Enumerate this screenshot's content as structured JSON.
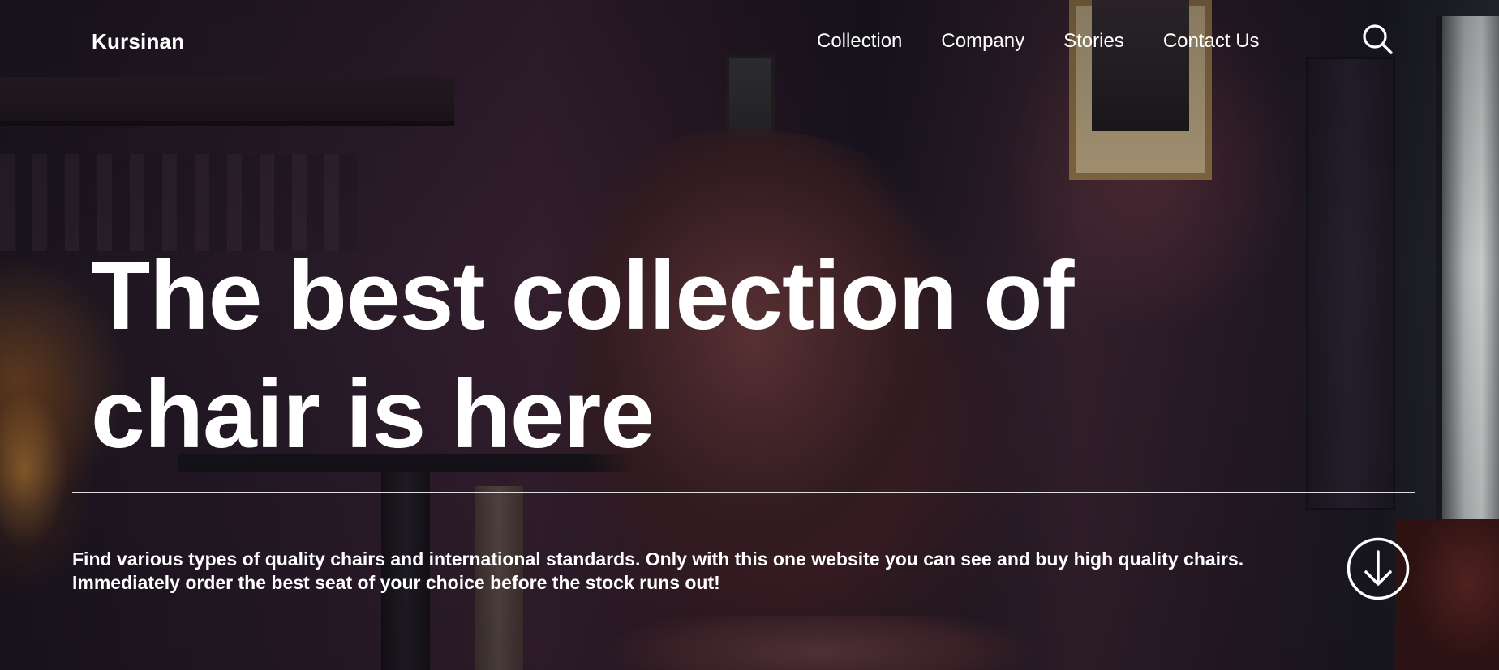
{
  "header": {
    "brand": "Kursinan",
    "nav": [
      {
        "label": "Collection"
      },
      {
        "label": "Company"
      },
      {
        "label": "Stories"
      },
      {
        "label": "Contact Us"
      }
    ],
    "search_icon": "search-icon"
  },
  "hero": {
    "headline_line1": "The best collection of",
    "headline_line2": "chair is here",
    "description_line1": "Find various types of quality chairs and international standards. Only with this one website you can see and buy high quality chairs.",
    "description_line2": "Immediately order the best seat of your choice before the stock runs out!",
    "scroll_icon": "arrow-down-circle-icon"
  },
  "colors": {
    "text": "#ffffff",
    "background_dark": "#1a1220",
    "chair_leather": "#5a2e32"
  }
}
